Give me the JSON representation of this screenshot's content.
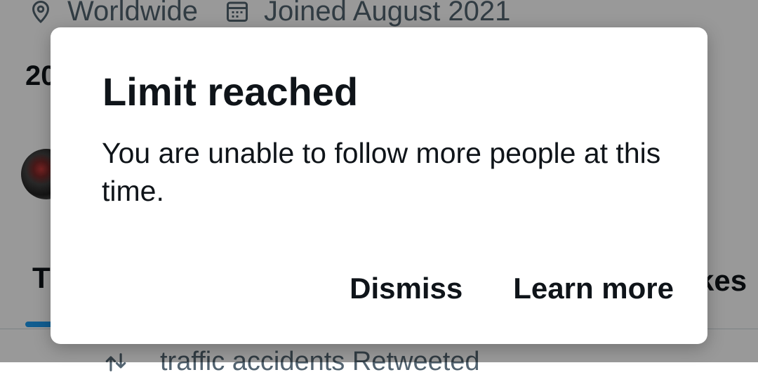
{
  "background": {
    "location": "Worldwide",
    "location_icon": "map-pin-icon",
    "joined": "Joined August 2021",
    "joined_icon": "calendar-icon",
    "following_count_partial": "20",
    "tabs": {
      "first_partial": "T",
      "last_partial": "kes"
    },
    "retweet_icon": "retweet-icon",
    "retweet_text": "traffic accidents Retweeted",
    "accent_color": "#1d9bf0"
  },
  "dialog": {
    "title": "Limit reached",
    "message": "You are unable to follow more people at this time.",
    "dismiss_label": "Dismiss",
    "learn_more_label": "Learn more"
  }
}
